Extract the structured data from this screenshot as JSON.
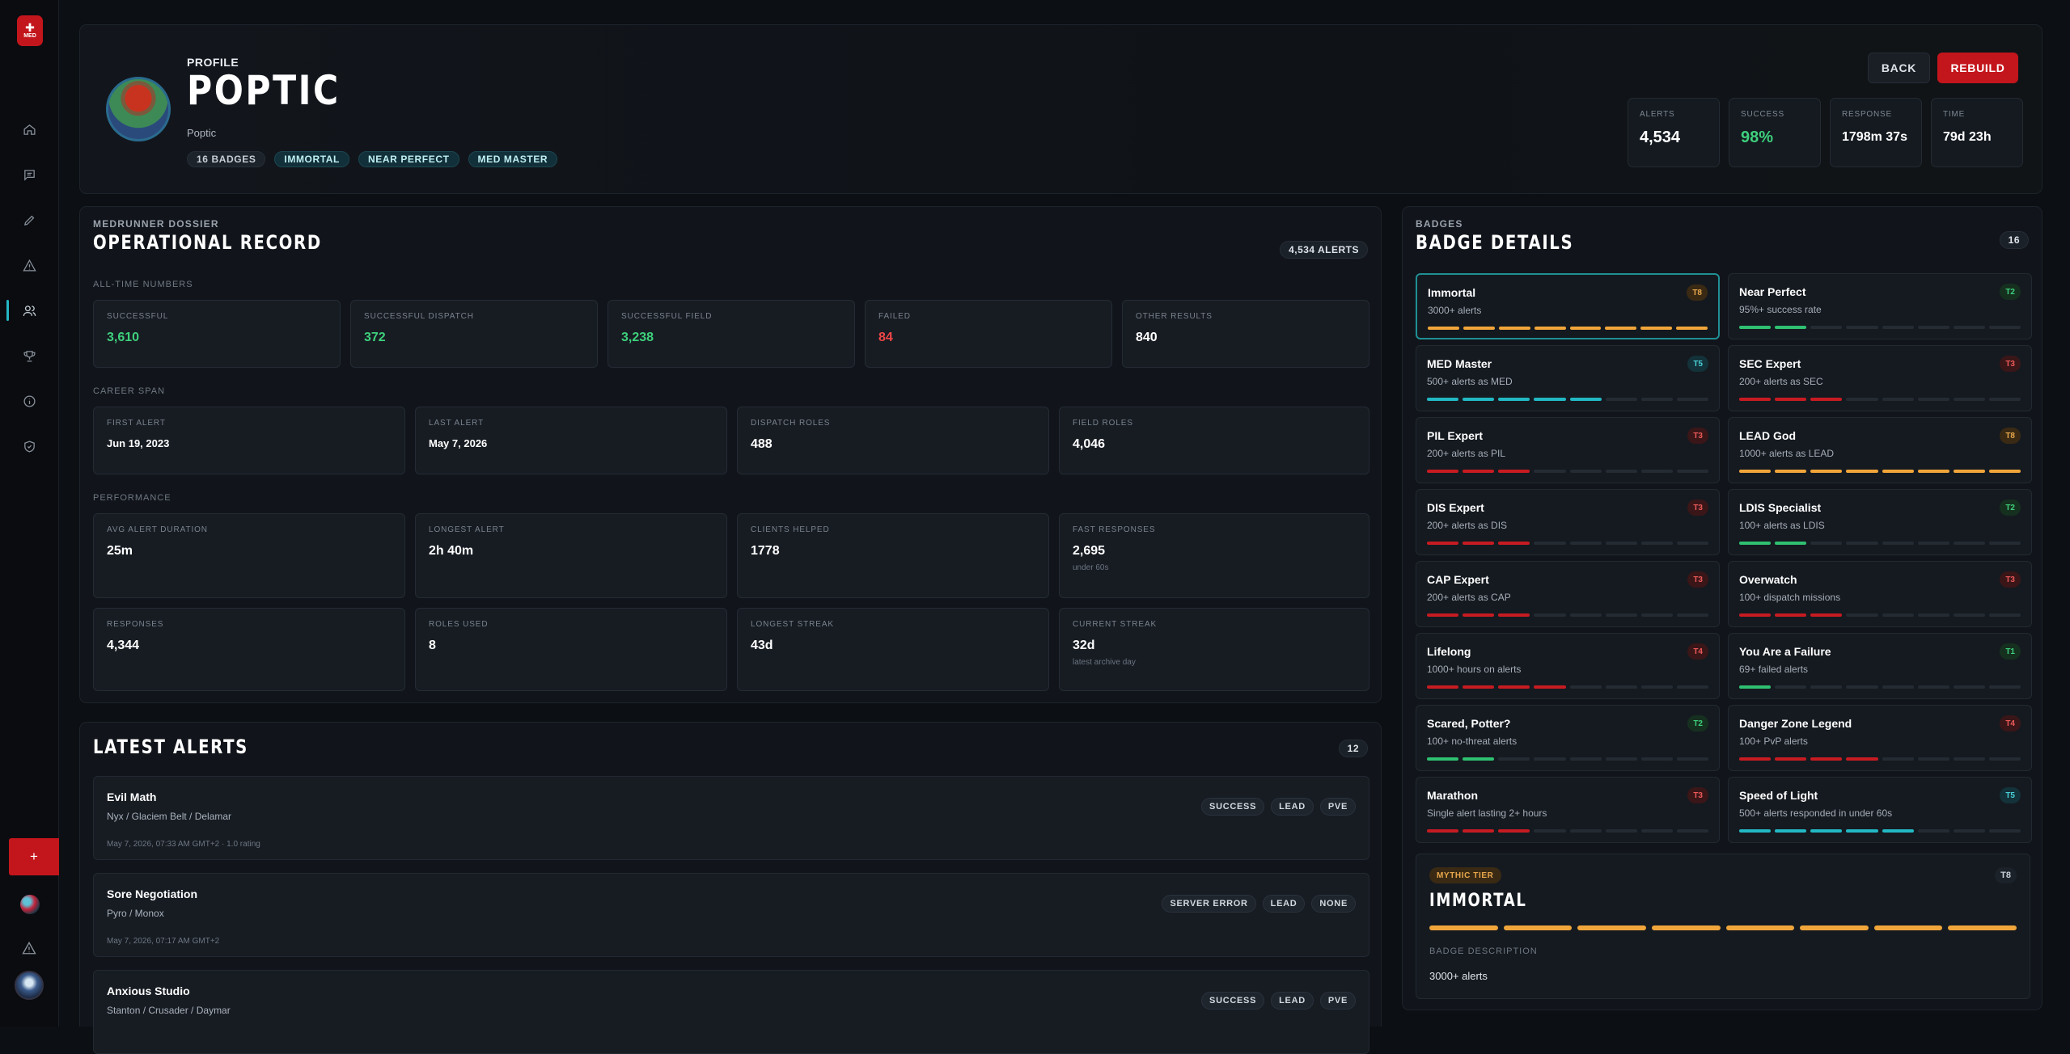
{
  "logo": {
    "text": "MED"
  },
  "sidebar": {
    "items": [
      {
        "icon": "home-icon"
      },
      {
        "icon": "message-icon"
      },
      {
        "icon": "pencil-icon"
      },
      {
        "icon": "alert-triangle-icon"
      },
      {
        "icon": "users-icon",
        "active": true
      },
      {
        "icon": "trophy-icon"
      },
      {
        "icon": "info-icon"
      },
      {
        "icon": "shield-check-icon"
      }
    ],
    "add_label": "+"
  },
  "profile": {
    "eyebrow": "PROFILE",
    "name": "POPTIC",
    "handle": "Poptic",
    "chips": [
      "16 BADGES",
      "IMMORTAL",
      "NEAR PERFECT",
      "MED MASTER"
    ],
    "back_label": "BACK",
    "rebuild_label": "REBUILD",
    "stats": [
      {
        "label": "ALERTS",
        "value": "4,534"
      },
      {
        "label": "SUCCESS",
        "value": "98%"
      },
      {
        "label": "RESPONSE",
        "value": "1798m 37s"
      },
      {
        "label": "TIME",
        "value": "79d 23h"
      }
    ]
  },
  "dossier": {
    "eyebrow": "MEDRUNNER DOSSIER",
    "title": "OPERATIONAL RECORD",
    "count": "4,534 ALERTS",
    "all_time_label": "ALL-TIME NUMBERS",
    "all_time": [
      {
        "label": "SUCCESSFUL",
        "value": "3,610"
      },
      {
        "label": "SUCCESSFUL DISPATCH",
        "value": "372"
      },
      {
        "label": "SUCCESSFUL FIELD",
        "value": "3,238"
      },
      {
        "label": "FAILED",
        "value": "84"
      },
      {
        "label": "OTHER RESULTS",
        "value": "840"
      }
    ],
    "career_label": "CAREER SPAN",
    "career": [
      {
        "label": "FIRST ALERT",
        "value": "Jun 19, 2023"
      },
      {
        "label": "LAST ALERT",
        "value": "May 7, 2026"
      },
      {
        "label": "DISPATCH ROLES",
        "value": "488"
      },
      {
        "label": "FIELD ROLES",
        "value": "4,046"
      }
    ],
    "performance_label": "PERFORMANCE",
    "performance": [
      {
        "label": "AVG ALERT DURATION",
        "value": "25m",
        "sub": ""
      },
      {
        "label": "LONGEST ALERT",
        "value": "2h 40m",
        "sub": ""
      },
      {
        "label": "CLIENTS HELPED",
        "value": "1778",
        "sub": ""
      },
      {
        "label": "FAST RESPONSES",
        "value": "2,695",
        "sub": "under 60s"
      },
      {
        "label": "RESPONSES",
        "value": "4,344",
        "sub": ""
      },
      {
        "label": "ROLES USED",
        "value": "8",
        "sub": ""
      },
      {
        "label": "LONGEST STREAK",
        "value": "43d",
        "sub": ""
      },
      {
        "label": "CURRENT STREAK",
        "value": "32d",
        "sub": "latest archive day"
      }
    ]
  },
  "latest_alerts": {
    "title": "LATEST ALERTS",
    "count": "12",
    "items": [
      {
        "title": "Evil Math",
        "location": "Nyx / Glaciem Belt / Delamar",
        "meta": "May 7, 2026, 07:33 AM GMT+2   ·   1.0 rating",
        "tags": [
          "SUCCESS",
          "LEAD",
          "PVE"
        ]
      },
      {
        "title": "Sore Negotiation",
        "location": "Pyro / Monox",
        "meta": "May 7, 2026, 07:17 AM GMT+2",
        "tags": [
          "SERVER ERROR",
          "LEAD",
          "NONE"
        ]
      },
      {
        "title": "Anxious Studio",
        "location": "Stanton / Crusader / Daymar",
        "meta": "",
        "tags": [
          "SUCCESS",
          "LEAD",
          "PVE"
        ]
      }
    ]
  },
  "badges": {
    "eyebrow": "BADGES",
    "title": "BADGE DETAILS",
    "count": "16",
    "items": [
      {
        "name": "Immortal",
        "desc": "3000+ alerts",
        "tier": "T8",
        "color": "gold",
        "fill": 8
      },
      {
        "name": "Near Perfect",
        "desc": "95%+ success rate",
        "tier": "T2",
        "color": "green",
        "fill": 2
      },
      {
        "name": "MED Master",
        "desc": "500+ alerts as MED",
        "tier": "T5",
        "color": "teal",
        "fill": 5
      },
      {
        "name": "SEC Expert",
        "desc": "200+ alerts as SEC",
        "tier": "T3",
        "color": "red",
        "fill": 3
      },
      {
        "name": "PIL Expert",
        "desc": "200+ alerts as PIL",
        "tier": "T3",
        "color": "red",
        "fill": 3
      },
      {
        "name": "LEAD God",
        "desc": "1000+ alerts as LEAD",
        "tier": "T8",
        "color": "gold",
        "fill": 8
      },
      {
        "name": "DIS Expert",
        "desc": "200+ alerts as DIS",
        "tier": "T3",
        "color": "red",
        "fill": 3
      },
      {
        "name": "LDIS Specialist",
        "desc": "100+ alerts as LDIS",
        "tier": "T2",
        "color": "green",
        "fill": 2
      },
      {
        "name": "CAP Expert",
        "desc": "200+ alerts as CAP",
        "tier": "T3",
        "color": "red",
        "fill": 3
      },
      {
        "name": "Overwatch",
        "desc": "100+ dispatch missions",
        "tier": "T3",
        "color": "red",
        "fill": 3
      },
      {
        "name": "Lifelong",
        "desc": "1000+ hours on alerts",
        "tier": "T4",
        "color": "red",
        "fill": 4
      },
      {
        "name": "You Are a Failure",
        "desc": "69+ failed alerts",
        "tier": "T1",
        "color": "green",
        "fill": 1
      },
      {
        "name": "Scared, Potter?",
        "desc": "100+ no-threat alerts",
        "tier": "T2",
        "color": "green",
        "fill": 2
      },
      {
        "name": "Danger Zone Legend",
        "desc": "100+ PvP alerts",
        "tier": "T4",
        "color": "red",
        "fill": 4
      },
      {
        "name": "Marathon",
        "desc": "Single alert lasting 2+ hours",
        "tier": "T3",
        "color": "red",
        "fill": 3
      },
      {
        "name": "Speed of Light",
        "desc": "500+ alerts responded in under 60s",
        "tier": "T5",
        "color": "teal",
        "fill": 5
      }
    ],
    "selected": {
      "tier_label": "MYTHIC TIER",
      "tier": "T8",
      "name": "IMMORTAL",
      "desc_label": "BADGE DESCRIPTION",
      "desc": "3000+ alerts"
    }
  }
}
